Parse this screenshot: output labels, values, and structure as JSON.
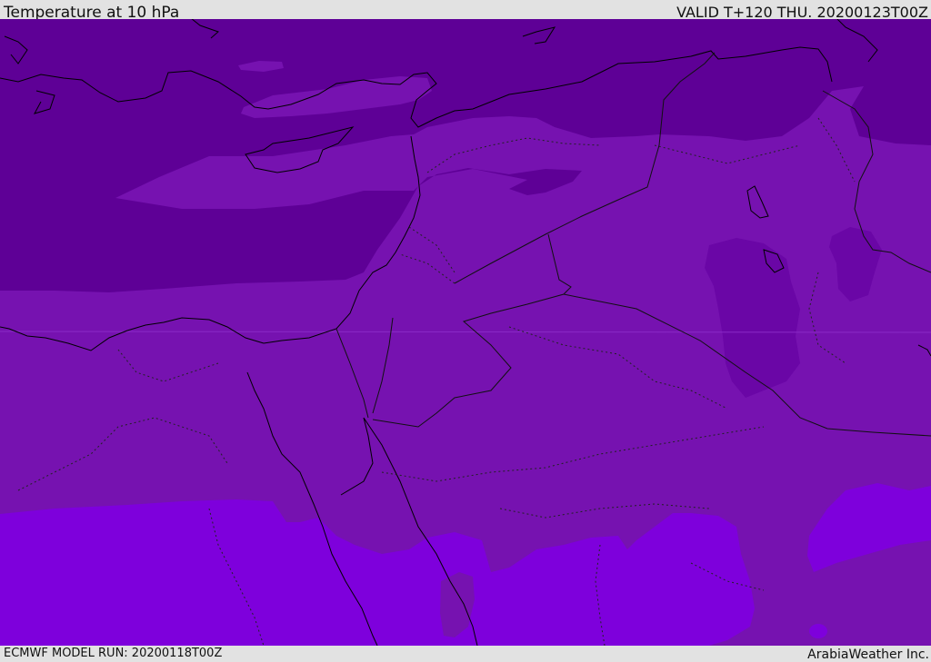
{
  "header": {
    "title": "Temperature at 10 hPa",
    "valid": "VALID T+120 THU. 20200123T00Z"
  },
  "footer": {
    "model_run": "ECMWF MODEL RUN: 20200118T00Z",
    "credit": "ArabiaWeather Inc."
  },
  "map": {
    "fill_colors": {
      "coldest": "#5e0096",
      "cold": "#7612b0",
      "mid": "#7f16c0",
      "warm": "#7e00dc",
      "boundary": "#000000"
    },
    "features": [
      "coastline",
      "country-borders",
      "province-borders",
      "temperature-contours"
    ]
  }
}
